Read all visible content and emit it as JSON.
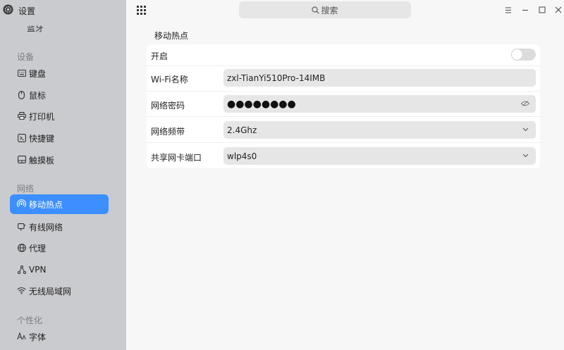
{
  "app": {
    "title": "设置",
    "clipped_item": "蓝牙"
  },
  "search": {
    "label": "搜索"
  },
  "sidebar": {
    "sections": [
      {
        "title": "设备",
        "items": [
          {
            "label": "键盘",
            "icon": "keyboard-icon"
          },
          {
            "label": "鼠标",
            "icon": "mouse-icon"
          },
          {
            "label": "打印机",
            "icon": "printer-icon"
          },
          {
            "label": "快捷键",
            "icon": "shortcut-icon"
          },
          {
            "label": "触摸板",
            "icon": "touchpad-icon"
          }
        ]
      },
      {
        "title": "网络",
        "items": [
          {
            "label": "移动热点",
            "icon": "hotspot-icon",
            "active": true
          },
          {
            "label": "有线网络",
            "icon": "wired-network-icon"
          },
          {
            "label": "代理",
            "icon": "proxy-icon"
          },
          {
            "label": "VPN",
            "icon": "vpn-icon"
          },
          {
            "label": "无线局域网",
            "icon": "wifi-icon"
          }
        ]
      },
      {
        "title": "个性化",
        "items": [
          {
            "label": "字体",
            "icon": "font-icon"
          }
        ]
      }
    ]
  },
  "main": {
    "title": "移动热点",
    "rows": {
      "enable": {
        "label": "开启",
        "on": false
      },
      "ssid": {
        "label": "Wi-Fi名称",
        "value": "zxl-TianYi510Pro-14IMB"
      },
      "password": {
        "label": "网络密码",
        "value": "●●●●●●●●"
      },
      "band": {
        "label": "网络频带",
        "value": "2.4Ghz"
      },
      "interface": {
        "label": "共享网卡端口",
        "value": "wlp4s0"
      }
    }
  },
  "colors": {
    "accent": "#3d8fff",
    "sidebar_bg": "#cacbcf",
    "content_bg": "#f7f7f7"
  }
}
